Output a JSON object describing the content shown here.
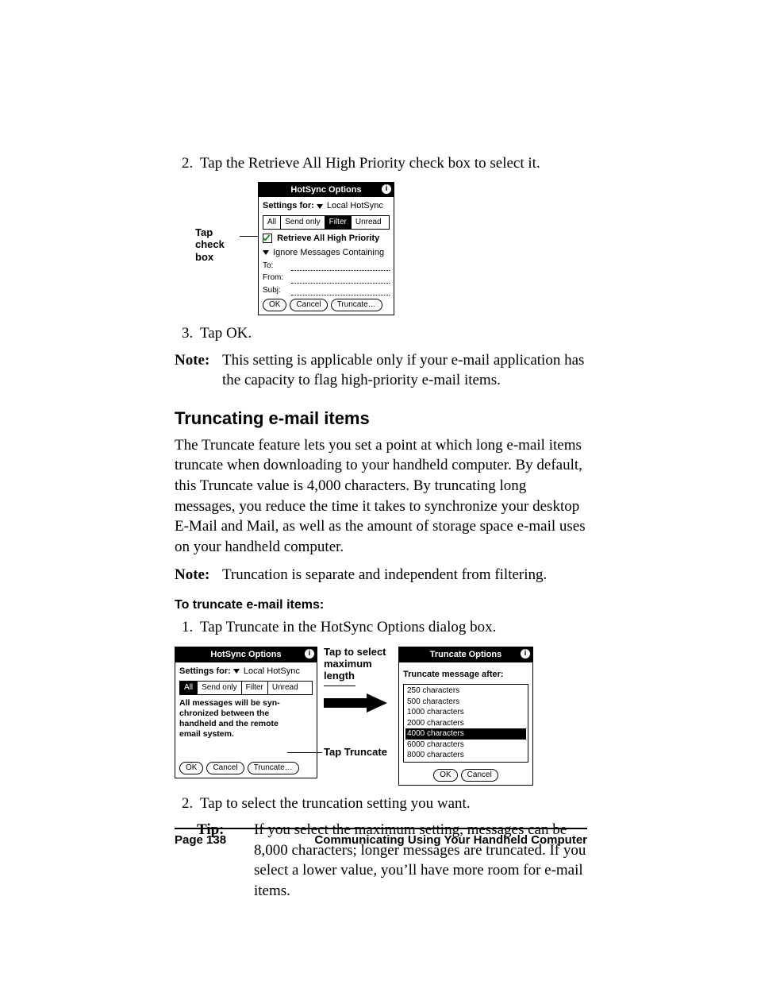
{
  "step2": "Tap the Retrieve All High Priority check box to select it.",
  "step3": "Tap OK.",
  "note1_label": "Note:",
  "note1_text": "This setting is applicable only if your e-mail application has the capacity to flag high-priority e-mail items.",
  "section_heading": "Truncating e-mail items",
  "section_para": "The Truncate feature lets you set a point at which long e-mail items truncate when downloading to your handheld computer. By default, this Truncate value is 4,000 characters. By truncating long messages, you reduce the time it takes to synchronize your desktop E-Mail and Mail, as well as the amount of storage space e-mail uses on your handheld computer.",
  "note2_label": "Note:",
  "note2_text": "Truncation is separate and independent from filtering.",
  "subhead": "To truncate e-mail items:",
  "proc_step1": "Tap Truncate in the HotSync Options dialog box.",
  "proc_step2": "Tap to select the truncation setting you want.",
  "tip_label": "Tip:",
  "tip_text": "If you select the maximum setting, messages can be 8,000 characters; longer messages are truncated. If you select a lower value, you’ll have more room for e-mail items.",
  "footer_left": "Page 138",
  "footer_right": "Communicating Using Your Handheld Computer",
  "fig1": {
    "caption": "Tap check box",
    "title": "HotSync Options",
    "settings_for": "Settings for:",
    "settings_val": "Local HotSync",
    "tabs": [
      "All",
      "Send only",
      "Filter",
      "Unread"
    ],
    "selected_tab": "Filter",
    "checkbox_label": "Retrieve All High Priority",
    "ignore_label": "Ignore Messages Containing",
    "fields": [
      "To:",
      "From:",
      "Subj:"
    ],
    "buttons": [
      "OK",
      "Cancel",
      "Truncate…"
    ]
  },
  "fig2": {
    "left": {
      "title": "HotSync Options",
      "settings_for": "Settings for:",
      "settings_val": "Local HotSync",
      "tabs": [
        "All",
        "Send only",
        "Filter",
        "Unread"
      ],
      "selected_tab": "All",
      "sync_msg": "All messages will be syn-\nchronized between the\nhandheld and the remote\nemail system.",
      "buttons": [
        "OK",
        "Cancel",
        "Truncate…"
      ]
    },
    "mid_top": "Tap to select maximum length",
    "mid_bottom": "Tap Truncate",
    "right": {
      "title": "Truncate Options",
      "subtitle": "Truncate message after:",
      "options": [
        "250 characters",
        "500 characters",
        "1000 characters",
        "2000 characters",
        "4000 characters",
        "6000 characters",
        "8000 characters"
      ],
      "selected_option": "4000 characters",
      "buttons": [
        "OK",
        "Cancel"
      ]
    }
  }
}
